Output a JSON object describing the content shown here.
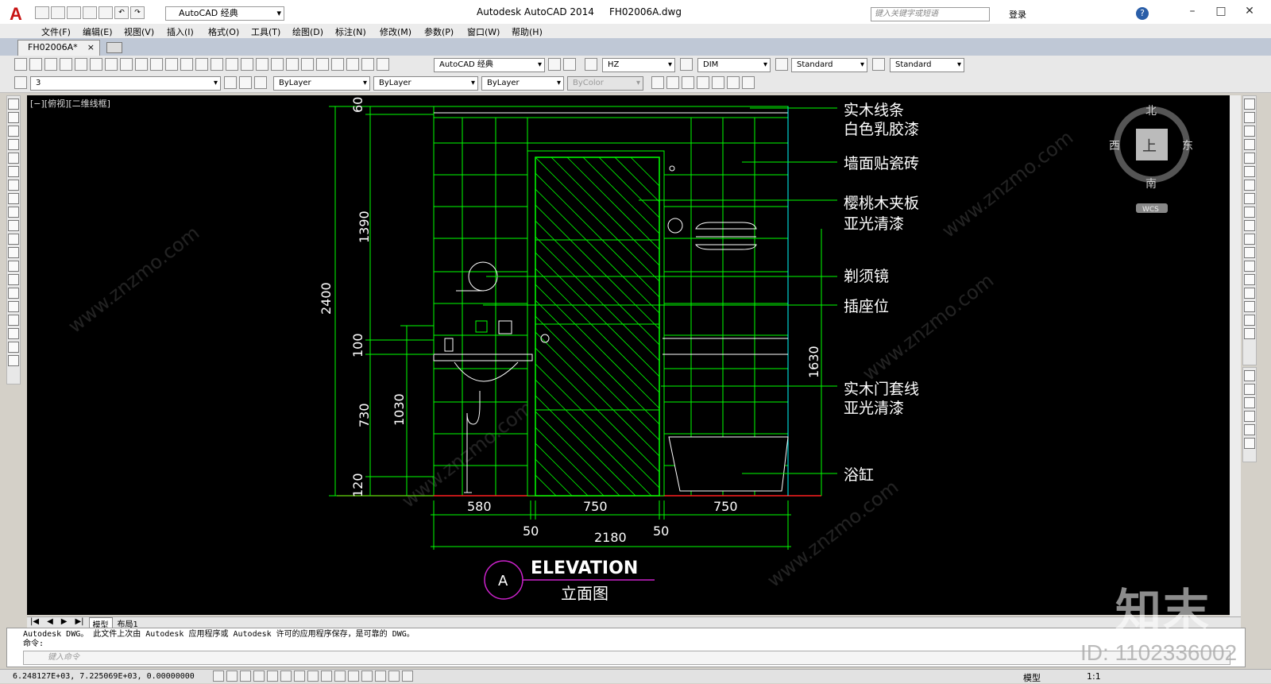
{
  "titlebar": {
    "app_name": "Autodesk AutoCAD 2014",
    "file_name": "FH02006A.dwg",
    "workspace": "AutoCAD 经典",
    "search_placeholder": "键入关键字或短语",
    "login_label": "登录",
    "help_label": "?"
  },
  "menu": [
    "文件(F)",
    "编辑(E)",
    "视图(V)",
    "插入(I)",
    "格式(O)",
    "工具(T)",
    "绘图(D)",
    "标注(N)",
    "修改(M)",
    "参数(P)",
    "窗口(W)",
    "帮助(H)"
  ],
  "doc_tab": {
    "label": "FH02006A*",
    "close": "×"
  },
  "toolbar": {
    "workspace": "AutoCAD 经典",
    "text_style": "HZ",
    "dim_style": "DIM",
    "table_style": "Standard",
    "multileader_style": "Standard",
    "layer": "3",
    "color": "ByLayer",
    "linetype": "ByLayer",
    "lineweight": "ByLayer",
    "plotstyle": "ByColor"
  },
  "viewport_label": "[−][俯视][二维线框]",
  "viewcube": {
    "north": "北",
    "south": "南",
    "east": "东",
    "west": "西",
    "top": "上",
    "wcs": "WCS"
  },
  "drawing": {
    "dims_left": {
      "total": "2400",
      "top": "60",
      "mid": "1390",
      "counter": "100",
      "lower": "730",
      "bottom": "120",
      "vanity": "1030"
    },
    "dim_right": "1630",
    "dims_bottom": {
      "seg1": "580",
      "seg2": "750",
      "seg3": "750",
      "gap1": "50",
      "gap2": "50",
      "total": "2180"
    },
    "labels": [
      "实木线条",
      "白色乳胶漆",
      "墙面贴瓷砖",
      "樱桃木夹板",
      "亚光清漆",
      "剃须镜",
      "插座位",
      "实木门套线",
      "亚光清漆",
      "浴缸"
    ],
    "title_marker": "A",
    "title_en": "ELEVATION",
    "title_cn": "立面图"
  },
  "layout_tabs": [
    "模型",
    "布局1"
  ],
  "command": {
    "history_line": "Autodesk DWG。  此文件上次由 Autodesk 应用程序或 Autodesk 许可的应用程序保存，是可靠的 DWG。",
    "prompt": "命令:",
    "input_placeholder": "键入命令"
  },
  "status": {
    "coords": "6.248127E+03,  7.225069E+03,  0.00000000",
    "model": "模型",
    "scale": "1:1"
  },
  "watermark": {
    "logo": "知末",
    "id": "ID: 1102336002",
    "site": "www.znzmo.com"
  },
  "colors": {
    "wall": "#00ff00",
    "dim": "#00ff00",
    "door_hatch": "#00ff00",
    "text": "#ffffff",
    "marker": "#cc22cc",
    "cyan": "#00ffff",
    "floor": "#ff0000"
  }
}
